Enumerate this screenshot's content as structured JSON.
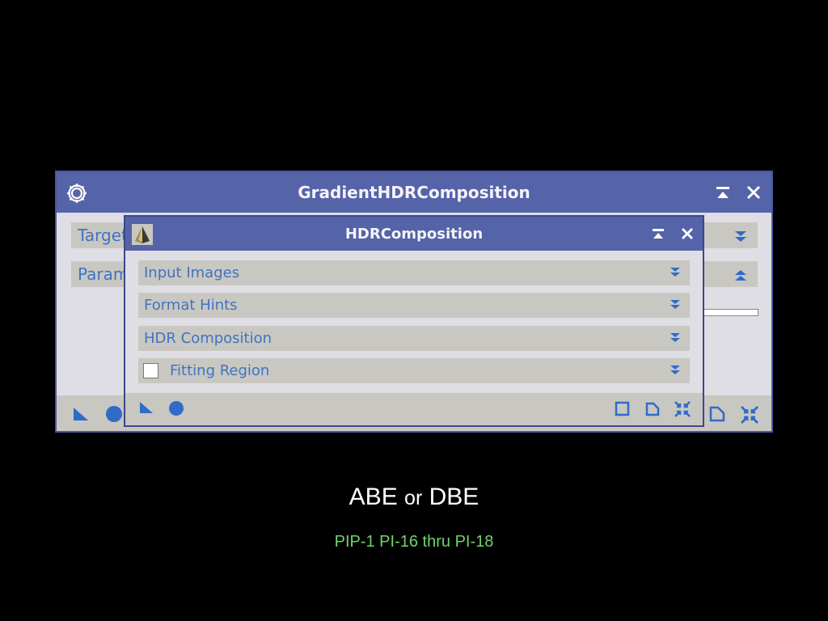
{
  "outer_window": {
    "title": "GradientHDRComposition",
    "sections": [
      {
        "label": "Target"
      },
      {
        "label": "Param"
      }
    ]
  },
  "inner_window": {
    "title": "HDRComposition",
    "sections": [
      {
        "label": "Input Images"
      },
      {
        "label": "Format Hints"
      },
      {
        "label": "HDR Composition"
      },
      {
        "label": "Fitting Region",
        "checkbox": false
      }
    ]
  },
  "caption": {
    "main_a": "ABE",
    "main_or": "or",
    "main_b": "DBE",
    "sub": "PIP-1 PI-16 thru PI-18"
  },
  "colors": {
    "titlebar": "#5563a8",
    "section_bg": "#c9c7c2",
    "section_text": "#3f74c0",
    "caption_sub": "#6fd46a"
  }
}
